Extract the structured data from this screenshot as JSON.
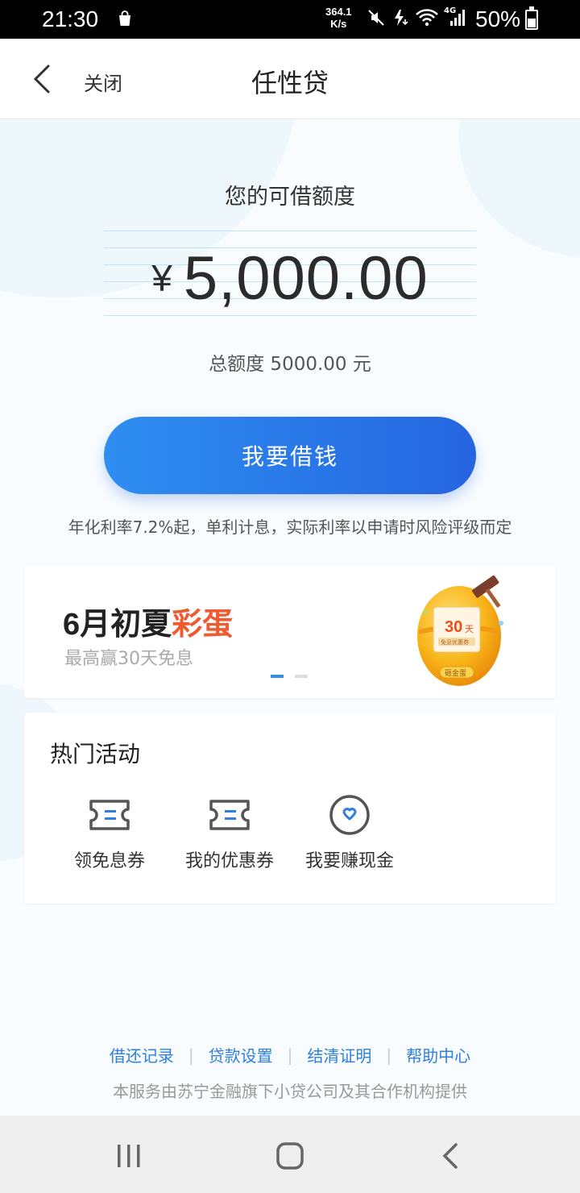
{
  "status_bar": {
    "time": "21:30",
    "net_speed": "364.1",
    "net_unit": "K/s",
    "network_type": "4G",
    "battery": "50%",
    "battery_level": 0.5,
    "icons": [
      "shopping-bag-icon",
      "mute-icon",
      "charging-icon",
      "wifi-icon",
      "cellular-signal-icon",
      "battery-icon"
    ]
  },
  "header": {
    "close_label": "关闭",
    "title": "任性贷"
  },
  "credit": {
    "label": "您的可借额度",
    "currency": "¥",
    "amount": "5,000.00",
    "total_text": "总额度 5000.00 元"
  },
  "borrow_button": "我要借钱",
  "rate_note": "年化利率7.2%起，单利计息，实际利率以申请时风险评级而定",
  "banner": {
    "title_main": "6月初夏",
    "title_highlight": "彩蛋",
    "subtitle": "最高赢30天免息",
    "egg_days": "30",
    "egg_unit": "天",
    "egg_coupon": "免息优惠券",
    "egg_label": "砸金蛋",
    "slides": 2,
    "active_slide": 0,
    "highlight_color": "#f05a30"
  },
  "activities": {
    "title": "热门活动",
    "items": [
      {
        "label": "领免息券",
        "icon": "coupon-icon"
      },
      {
        "label": "我的优惠券",
        "icon": "ticket-icon"
      },
      {
        "label": "我要赚现金",
        "icon": "heart-badge-icon"
      }
    ]
  },
  "footer": {
    "links": [
      "借还记录",
      "贷款设置",
      "结清证明",
      "帮助中心"
    ],
    "note": "本服务由苏宁金融旗下小贷公司及其合作机构提供"
  },
  "colors": {
    "accent": "#2e7fe0",
    "button_gradient_start": "#2e8ef1",
    "button_gradient_end": "#2565e0"
  }
}
